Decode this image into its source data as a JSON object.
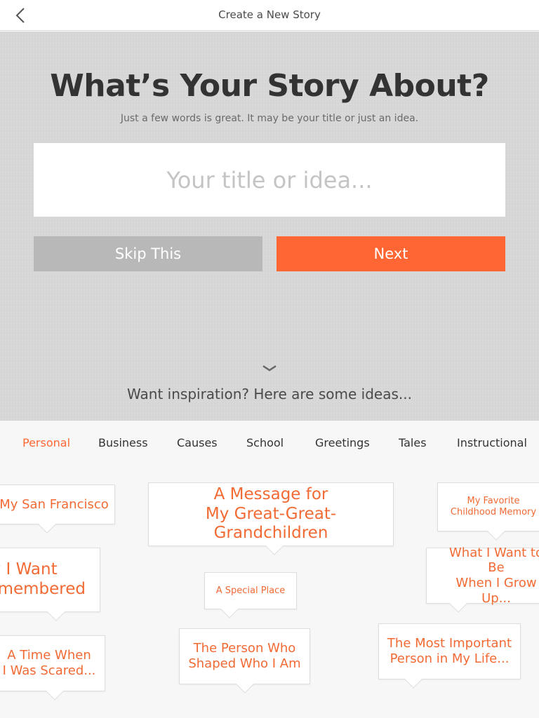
{
  "header": {
    "title": "Create a New Story"
  },
  "hero": {
    "title": "What’s Your Story About?",
    "subtitle": "Just a few words is great. It may be your title or just an idea.",
    "input_placeholder": "Your title or idea...",
    "input_value": "",
    "skip_label": "Skip This",
    "next_label": "Next",
    "inspiration": "Want inspiration? Here are some ideas..."
  },
  "tabs": [
    {
      "label": "Personal",
      "active": true
    },
    {
      "label": "Business"
    },
    {
      "label": "Causes"
    },
    {
      "label": "School"
    },
    {
      "label": "Greetings"
    },
    {
      "label": "Tales"
    },
    {
      "label": "Instructional"
    }
  ],
  "ideas": [
    {
      "text": "My San Francisco"
    },
    {
      "text": "A Message for\nMy Great-Great-Grandchildren"
    },
    {
      "text": "My Favorite\nChildhood Memory"
    },
    {
      "text": "w I Want\nemembered"
    },
    {
      "text": "A Special Place"
    },
    {
      "text": "What I Want to Be\nWhen I Grow Up..."
    },
    {
      "text": "A Time When\nI Was Scared..."
    },
    {
      "text": "The Person Who\nShaped Who I Am"
    },
    {
      "text": "The Most Important\nPerson in My Life..."
    }
  ],
  "colors": {
    "accent": "#ff6633",
    "skip": "#b8b8b8",
    "text_dark": "#333333"
  },
  "icons": {
    "back": "chevron-left-icon",
    "expand": "chevron-down-icon"
  }
}
